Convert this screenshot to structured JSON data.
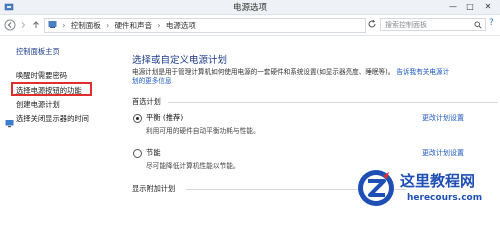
{
  "window": {
    "title": "电源选项",
    "icon": "power-options-icon",
    "controls": [
      "—",
      "□",
      "✕"
    ]
  },
  "addressbar": {
    "back_icon": "back-arrow-icon",
    "forward_icon": "forward-arrow-icon",
    "up_icon": "up-arrow-icon",
    "breadcrumbs": [
      "控制面板",
      "硬件和声音",
      "电源选项"
    ],
    "search_placeholder": "搜索控制面板",
    "search_icon": "search-icon",
    "refresh_icon": "refresh-icon"
  },
  "sidebar": {
    "home": "控制面板主页",
    "items": [
      "唤醒时需要密码",
      "选择电源按钮的功能",
      "创建电源计划",
      "选择关闭显示器的时间"
    ],
    "highlighted_index": 1,
    "highlight_color": "#e02d2d"
  },
  "main": {
    "title": "选择或自定义电源计划",
    "description": "电源计划是用于管理计算机如何使用电源的一套硬件和系统设置(如显示器亮度、睡眠等)。",
    "description_link_1": "告诉我有关电源计",
    "description_link_2": "划的更多信息",
    "preferred_group": "首选计划",
    "plans": [
      {
        "name": "平衡 (推荐)",
        "desc": "利用可用的硬件自动平衡功耗与性能。",
        "link": "更改计划设置",
        "selected": true
      },
      {
        "name": "节能",
        "desc": "尽可能降低计算机性能以节能。",
        "link": "更改计划设置",
        "selected": false
      }
    ],
    "additional_group": "显示附加计划"
  },
  "watermark": {
    "text": "这里教程网",
    "url": "herecours.com",
    "color": "#1f4fb5"
  },
  "colors": {
    "link": "#1a56c2",
    "title": "#1b3a8a"
  }
}
